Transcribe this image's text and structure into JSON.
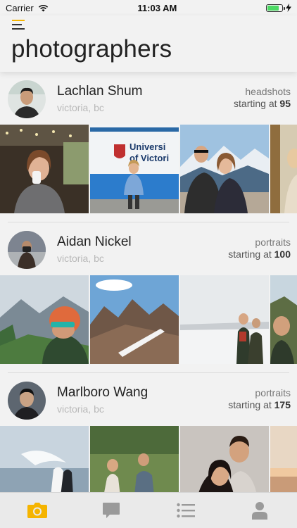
{
  "status_bar": {
    "carrier": "Carrier",
    "time": "11:03 AM"
  },
  "header": {
    "title": "photographers"
  },
  "accent_color": "#f5b400",
  "photographers": [
    {
      "name": "Lachlan Shum",
      "location": "victoria, bc",
      "category": "headshots",
      "price_prefix": "starting at",
      "price": "95"
    },
    {
      "name": "Aidan Nickel",
      "location": "victoria, bc",
      "category": "portraits",
      "price_prefix": "starting at",
      "price": "100"
    },
    {
      "name": "Marlboro Wang",
      "location": "victoria, bc",
      "category": "portraits",
      "price_prefix": "starting at",
      "price": "175"
    }
  ],
  "tabs": [
    {
      "icon": "camera-icon",
      "active": true
    },
    {
      "icon": "chat-bubble-icon",
      "active": false
    },
    {
      "icon": "list-icon",
      "active": false
    },
    {
      "icon": "profile-icon",
      "active": false
    }
  ]
}
